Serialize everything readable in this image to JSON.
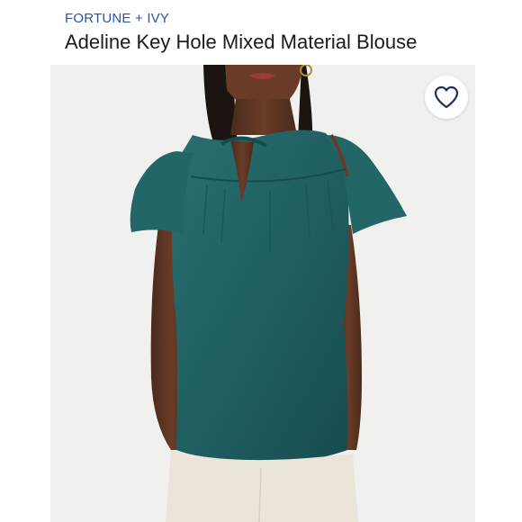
{
  "product": {
    "brand": "FORTUNE + IVY",
    "title": "Adeline Key Hole Mixed Material Blouse"
  },
  "favorite": {
    "icon": "heart-outline-icon"
  },
  "photo": {
    "subject": "product-model-photo"
  },
  "colors": {
    "brand_text": "#2b52a8",
    "blouse": "#1f5f62",
    "background": "#f0f0ef"
  }
}
